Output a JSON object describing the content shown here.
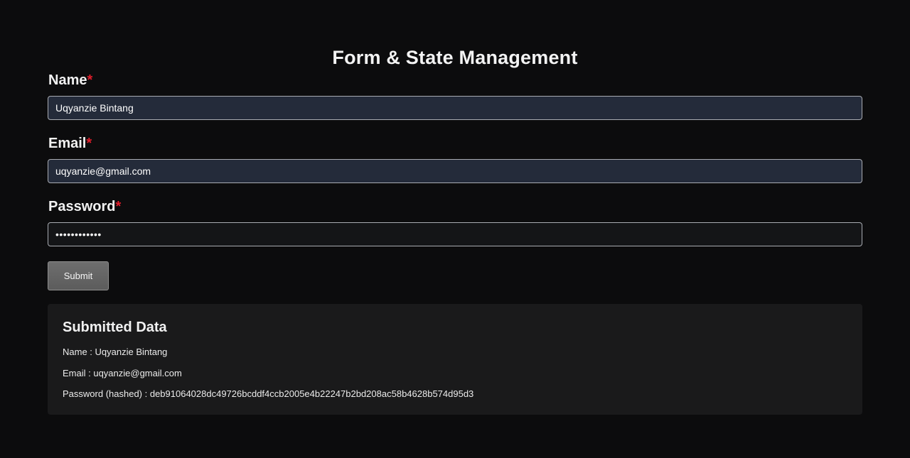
{
  "page": {
    "title": "Form & State Management"
  },
  "form": {
    "name": {
      "label": "Name",
      "required_mark": "*",
      "value": "Uqyanzie Bintang"
    },
    "email": {
      "label": "Email",
      "required_mark": "*",
      "value": "uqyanzie@gmail.com"
    },
    "password": {
      "label": "Password",
      "required_mark": "*",
      "value": "••••••••••••"
    },
    "submit_label": "Submit"
  },
  "submitted": {
    "title": "Submitted Data",
    "name_line": "Name : Uqyanzie Bintang",
    "email_line": "Email : uqyanzie@gmail.com",
    "password_line": "Password (hashed) : deb91064028dc49726bcddf4ccb2005e4b22247b2bd208ac58b4628b574d95d3"
  },
  "colors": {
    "background": "#0c0c0d",
    "input_filled": "#242b3a",
    "input_dark": "#141517",
    "required": "#e11d2a",
    "panel": "#1a1a1b",
    "button": "#666666"
  }
}
